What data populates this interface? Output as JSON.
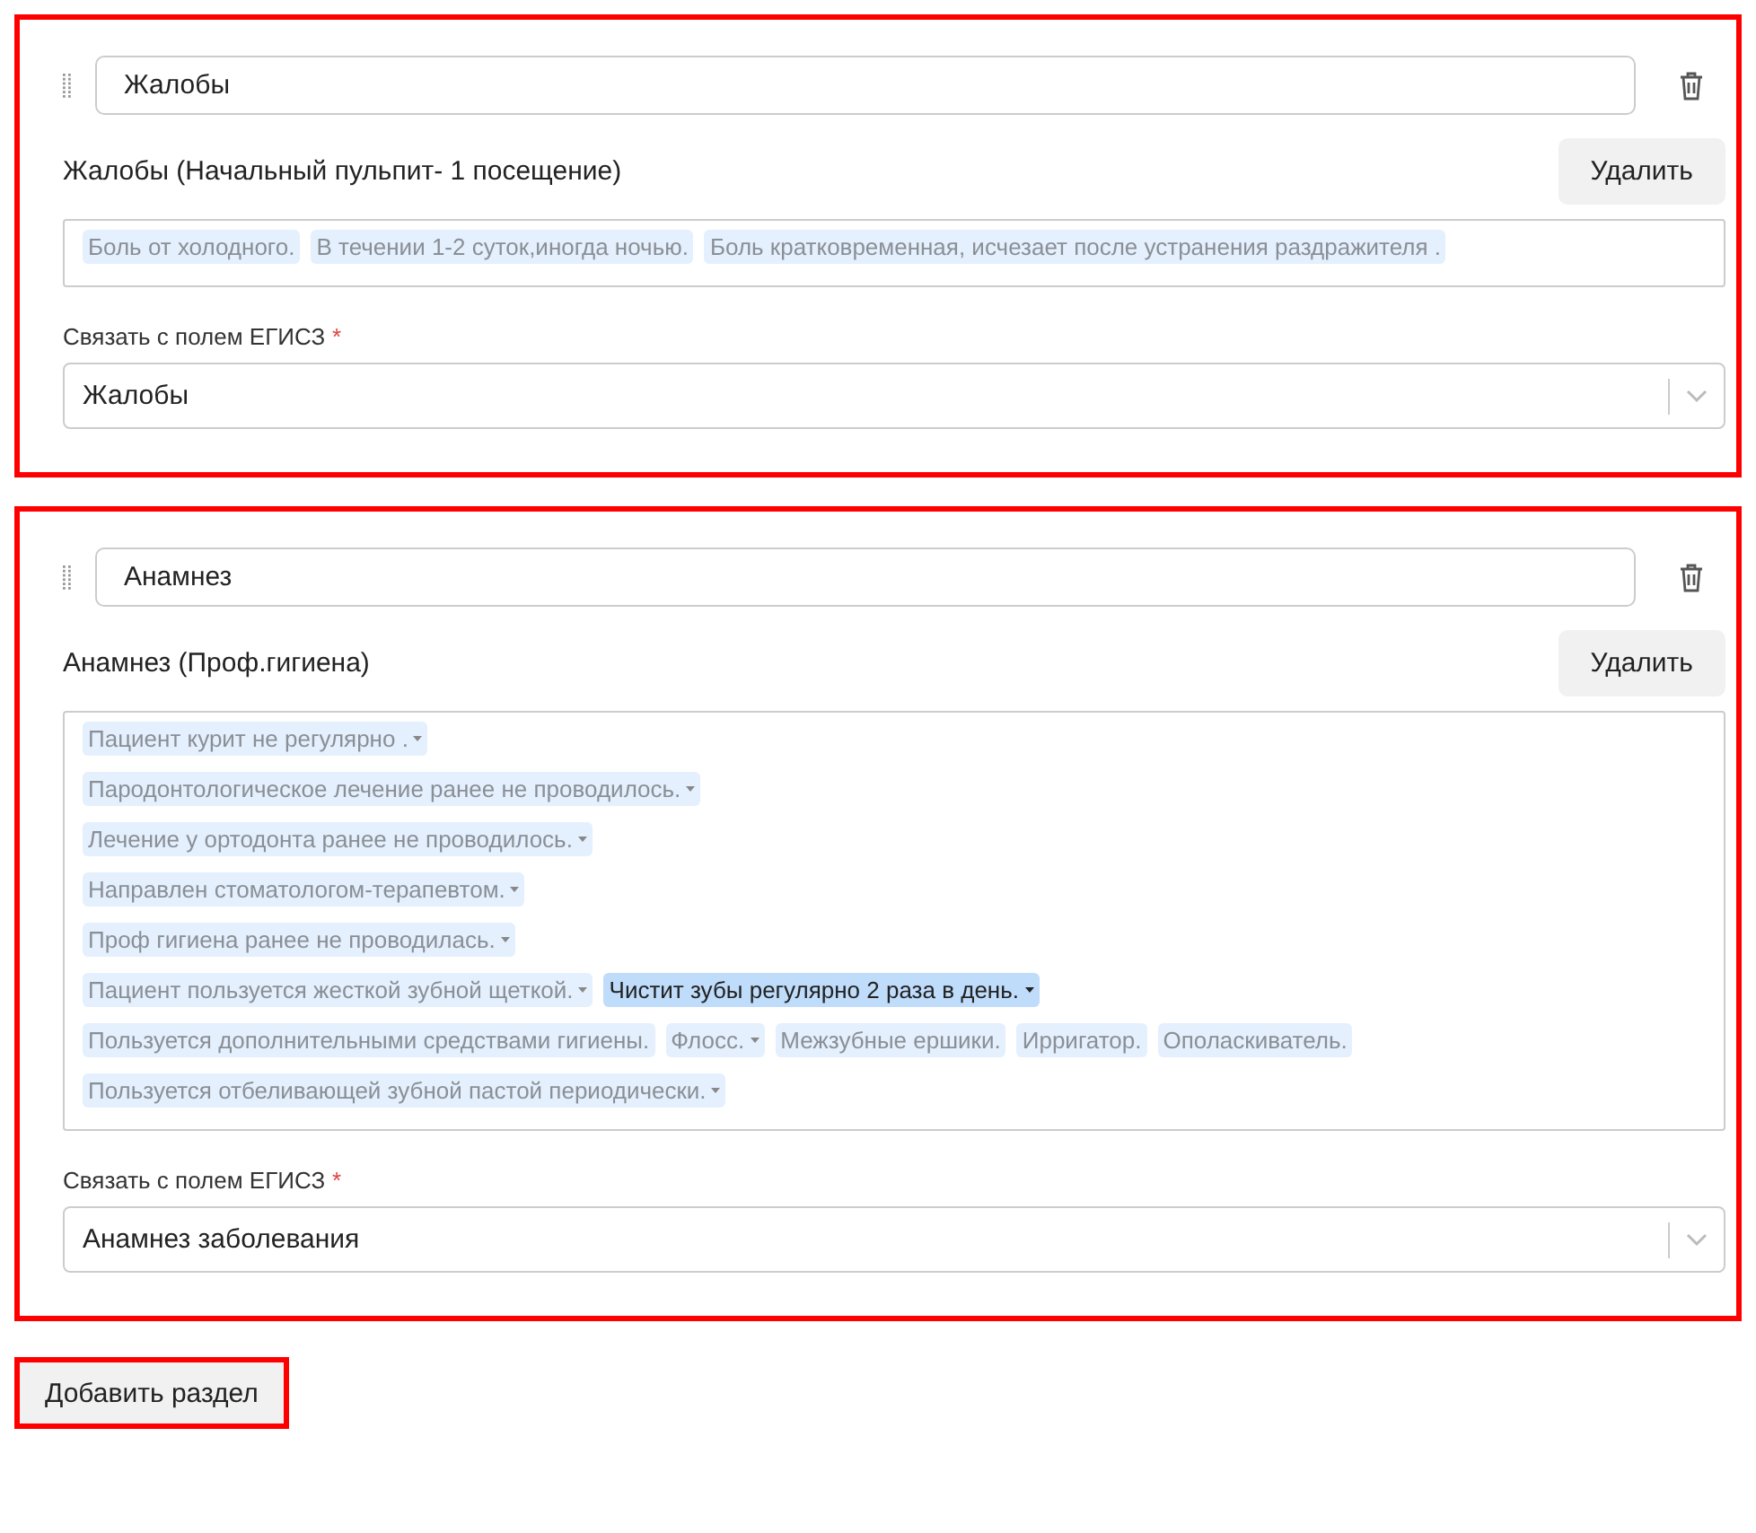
{
  "sections": [
    {
      "name": "Жалобы",
      "template_title": "Жалобы (Начальный пульпит- 1 посещение)",
      "delete_label": "Удалить",
      "highlighted": true,
      "tag_lines": [
        [
          {
            "text": "Боль от холодного.",
            "dropdown": false,
            "selected": false
          },
          {
            "text": "В течении 1-2 суток,иногда ночью.",
            "dropdown": false,
            "selected": false
          },
          {
            "text": "Боль кратковременная, исчезает после устранения раздражителя .",
            "dropdown": false,
            "selected": false
          }
        ]
      ],
      "link_label": "Связать с полем ЕГИСЗ",
      "required_mark": "*",
      "link_value": "Жалобы"
    },
    {
      "name": "Анамнез",
      "template_title": "Анамнез (Проф.гигиена)",
      "delete_label": "Удалить",
      "highlighted": true,
      "tag_lines": [
        [
          {
            "text": "Пациент курит не регулярно .",
            "dropdown": true,
            "selected": false
          }
        ],
        [
          {
            "text": "Пародонтологическое лечение ранее не проводилось.",
            "dropdown": true,
            "selected": false
          }
        ],
        [
          {
            "text": "Лечение у ортодонта ранее не проводилось.",
            "dropdown": true,
            "selected": false
          }
        ],
        [
          {
            "text": "Направлен стоматологом-терапевтом.",
            "dropdown": true,
            "selected": false
          }
        ],
        [
          {
            "text": "Проф гигиена ранее не проводилась.",
            "dropdown": true,
            "selected": false
          }
        ],
        [
          {
            "text": "Пациент пользуется жесткой зубной щеткой.",
            "dropdown": true,
            "selected": false
          },
          {
            "text": "Чистит зубы регулярно 2 раза в день.",
            "dropdown": true,
            "selected": true
          }
        ],
        [
          {
            "text": "Пользуется дополнительными средствами гигиены.",
            "dropdown": false,
            "selected": false
          },
          {
            "text": "Флосс.",
            "dropdown": true,
            "selected": false
          },
          {
            "text": "Межзубные ершики.",
            "dropdown": false,
            "selected": false
          },
          {
            "text": "Ирригатор.",
            "dropdown": false,
            "selected": false
          },
          {
            "text": "Ополаскиватель.",
            "dropdown": false,
            "selected": false
          }
        ],
        [
          {
            "text": "Пользуется отбеливающей зубной пастой периодически.",
            "dropdown": true,
            "selected": false
          }
        ]
      ],
      "link_label": "Связать с полем ЕГИСЗ",
      "required_mark": "*",
      "link_value": "Анамнез заболевания"
    }
  ],
  "add_button": {
    "label": "Добавить раздел",
    "highlighted": true
  }
}
